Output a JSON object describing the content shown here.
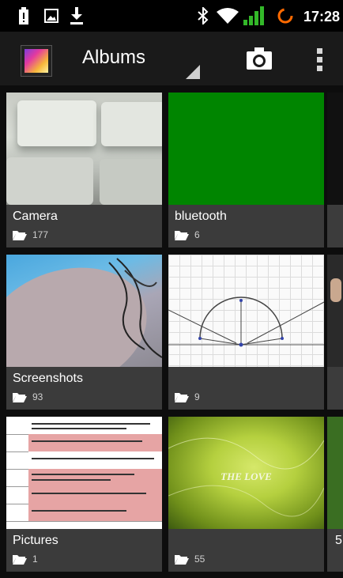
{
  "status_bar": {
    "time": "17:28",
    "left_icons": [
      "battery-alert-icon",
      "image-notification-icon",
      "download-icon"
    ],
    "right_icons": [
      "bluetooth-icon",
      "wifi-icon",
      "signal-icon",
      "sync-icon"
    ],
    "signal_color": "#33b829"
  },
  "action_bar": {
    "title": "Albums",
    "camera_icon": "camera-icon",
    "overflow_icon": "overflow-menu-icon"
  },
  "albums": [
    {
      "name": "Camera",
      "count": "177"
    },
    {
      "name": "bluetooth",
      "count": "6"
    },
    {
      "name": "Screenshots",
      "count": "93"
    },
    {
      "name": "",
      "count": "9"
    },
    {
      "name": "Pictures",
      "count": "1"
    },
    {
      "name": "",
      "count": "55"
    }
  ],
  "thumb_texts": {
    "love_caption": "THE LOVE"
  },
  "peek_column": {
    "row3_label": "5"
  },
  "colors": {
    "background": "#0b0b0b",
    "action_bar": "#1a1a1a",
    "label_bar": "#3c3c3c",
    "bluetooth_thumb": "#008500"
  }
}
